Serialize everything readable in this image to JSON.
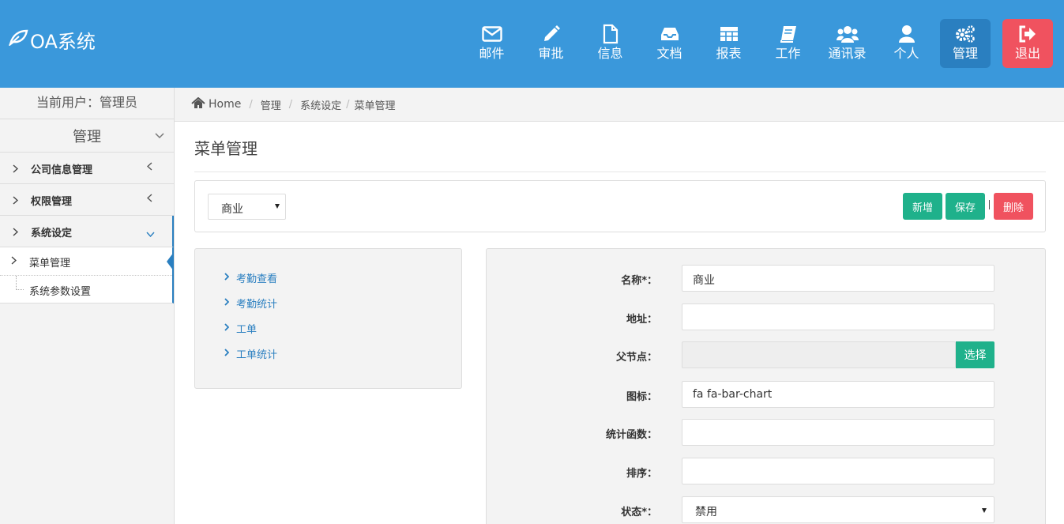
{
  "app": {
    "title": "OA系统"
  },
  "nav": [
    {
      "label": "邮件",
      "icon": "envelope-icon"
    },
    {
      "label": "审批",
      "icon": "pencil-icon"
    },
    {
      "label": "信息",
      "icon": "file-icon"
    },
    {
      "label": "文档",
      "icon": "inbox-icon"
    },
    {
      "label": "报表",
      "icon": "table-icon"
    },
    {
      "label": "工作",
      "icon": "book-icon"
    },
    {
      "label": "通讯录",
      "icon": "users-icon"
    },
    {
      "label": "个人",
      "icon": "user-icon"
    },
    {
      "label": "管理",
      "icon": "cogs-icon",
      "active": true
    },
    {
      "label": "退出",
      "icon": "sign-out-icon"
    }
  ],
  "sidebar": {
    "current_user": "当前用户：管理员",
    "section_title": "管理",
    "items": [
      {
        "label": "公司信息管理"
      },
      {
        "label": "权限管理"
      },
      {
        "label": "系统设定"
      }
    ],
    "sub_items": [
      {
        "label": "菜单管理"
      },
      {
        "label": "系统参数设置"
      }
    ]
  },
  "breadcrumb": {
    "home": "Home",
    "items": [
      "管理",
      "系统设定",
      "菜单管理"
    ]
  },
  "page": {
    "title": "菜单管理"
  },
  "toolbar": {
    "select_value": "商业",
    "add_label": "新增",
    "save_label": "保存",
    "delete_label": "删除"
  },
  "tree": [
    "考勤查看",
    "考勤统计",
    "工单",
    "工单统计"
  ],
  "form": {
    "name_label": "名称*：",
    "name_value": "商业",
    "address_label": "地址：",
    "address_value": "",
    "parent_label": "父节点：",
    "parent_value": "",
    "pick_label": "选择",
    "icon_label": "图标：",
    "icon_value": "fa fa-bar-chart",
    "func_label": "统计函数：",
    "func_value": "",
    "order_label": "排序：",
    "order_value": "",
    "status_label": "状态*：",
    "status_value": "禁用"
  },
  "colors": {
    "topbar": "#3a98db",
    "active_nav": "#2a7fc0",
    "logout": "#f0525f",
    "green": "#1fb18b",
    "link": "#2a7fc0"
  }
}
